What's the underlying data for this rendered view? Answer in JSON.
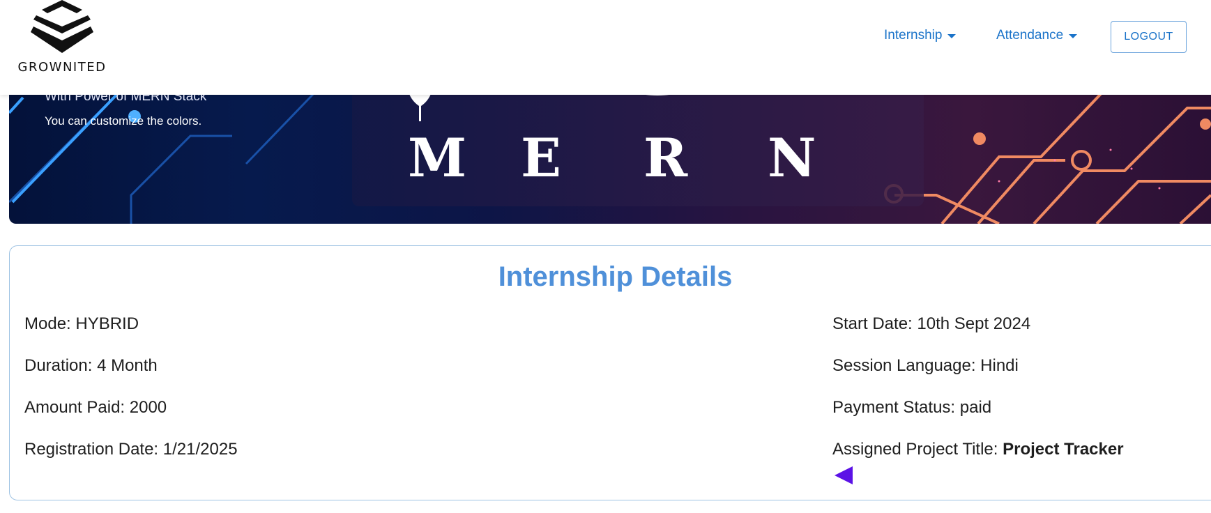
{
  "brand": {
    "name": "GROWNITED"
  },
  "nav": {
    "internship_label": "Internship",
    "attendance_label": "Attendance",
    "logout_label": "LOGOUT"
  },
  "banner": {
    "subtitle": "With Power of MERN Stack",
    "note": "You can customize the colors.",
    "letters": [
      "M",
      "E",
      "R",
      "N"
    ]
  },
  "details": {
    "title": "Internship Details",
    "mode": {
      "label": "Mode:",
      "value": "HYBRID"
    },
    "duration": {
      "label": "Duration:",
      "value": "4 Month"
    },
    "amount_paid": {
      "label": "Amount Paid:",
      "value": "2000"
    },
    "registration_date": {
      "label": "Registration Date:",
      "value": "1/21/2025"
    },
    "start_date": {
      "label": "Start Date:",
      "value": "10th Sept 2024"
    },
    "session_language": {
      "label": "Session Language:",
      "value": "Hindi"
    },
    "payment_status": {
      "label": "Payment Status:",
      "value": "paid"
    },
    "project_title": {
      "label": "Assigned Project Title:",
      "value": "Project Tracker"
    }
  },
  "colors": {
    "accent": "#1a73c9",
    "title": "#4f90d9",
    "back_arrow": "#5b12e6"
  },
  "icons": {
    "brand": "chevron-logo-icon",
    "caret": "caret-down-icon",
    "back": "back-arrow-icon"
  }
}
